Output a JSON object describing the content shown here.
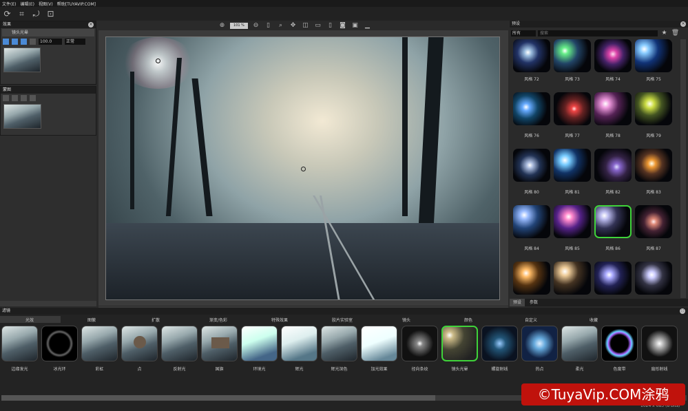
{
  "menu": [
    "文件(E)",
    "编辑(E)",
    "视图(V)",
    "帮助[TUYAVIP.COM]"
  ],
  "left": {
    "effects_title": "效果",
    "layer_name": "镜头光晕",
    "opacity": "100.0",
    "blend": "正常",
    "mask_title": "蒙图"
  },
  "canvas_toolbar": {
    "zoom": "101 %"
  },
  "presets": {
    "title": "预设",
    "filter_select": "所有",
    "search_placeholder": "搜索",
    "items": [
      "风格 72",
      "风格 73",
      "风格 74",
      "风格 75",
      "风格 76",
      "风格 77",
      "风格 78",
      "风格 79",
      "风格 80",
      "风格 81",
      "风格 82",
      "风格 83",
      "风格 84",
      "风格 85",
      "风格 86",
      "风格 87"
    ],
    "tab_presets": "预设",
    "tab_params": "参数"
  },
  "filters": {
    "title": "滤镜",
    "categories": [
      "光效",
      "图徽",
      "扩散",
      "渐变/色彩",
      "特殊效果",
      "胶片实验室",
      "镜头",
      "颜色",
      "自定义",
      "收藏"
    ],
    "items": [
      "边缘发光",
      "冰光环",
      "彩虹",
      "点",
      "反射光",
      "国旗",
      "环境光",
      "辉光",
      "辉光深色",
      "加光效果",
      "径向条纹",
      "镜头光晕",
      "螺旋射线",
      "热点",
      "柔光",
      "色度带",
      "扇形射线"
    ]
  },
  "status": "1024 x 683 (8 bits)",
  "watermark": "©TuyaVip.COM涂鸦"
}
